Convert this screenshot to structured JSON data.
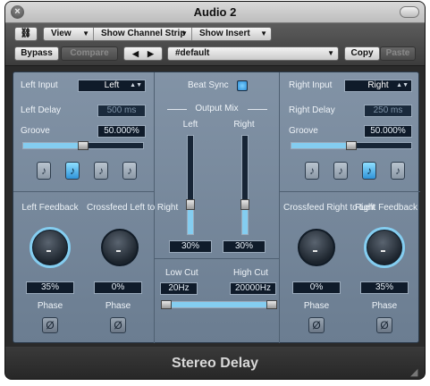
{
  "window": {
    "title": "Audio 2"
  },
  "toolbar": {
    "link_label": "🔗",
    "view": "View",
    "show_channel_strip": "Show Channel Strip",
    "show_insert": "Show Insert",
    "bypass": "Bypass",
    "compare": "Compare",
    "prev": "◀",
    "next": "▶",
    "preset": "#default",
    "copy": "Copy",
    "paste": "Paste"
  },
  "left": {
    "input_label": "Left Input",
    "input_value": "Left",
    "delay_label": "Left Delay",
    "delay_value": "500 ms",
    "groove_label": "Groove",
    "groove_value": "50.000%",
    "groove_fraction": 0.5,
    "notes": [
      "♪",
      "♪",
      "♪",
      "♪"
    ],
    "active_note": 1,
    "feedback_label": "Left Feedback",
    "feedback_value": "35%",
    "feedback_fraction": 0.35,
    "crossfeed_label": "Crossfeed Left to Right",
    "crossfeed_value": "0%",
    "phase_label": "Phase",
    "phase_symbol": "Ø"
  },
  "center": {
    "beat_sync_label": "Beat Sync",
    "output_mix_label": "Output Mix",
    "left_label": "Left",
    "right_label": "Right",
    "left_value": "30%",
    "right_value": "30%",
    "left_fraction": 0.3,
    "right_fraction": 0.3,
    "low_cut_label": "Low Cut",
    "high_cut_label": "High Cut",
    "low_cut_value": "20Hz",
    "high_cut_value": "20000Hz"
  },
  "right": {
    "input_label": "Right Input",
    "input_value": "Right",
    "delay_label": "Right Delay",
    "delay_value": "250 ms",
    "groove_label": "Groove",
    "groove_value": "50.000%",
    "groove_fraction": 0.5,
    "notes": [
      "♪",
      "♪",
      "♪",
      "♪"
    ],
    "active_note": 2,
    "crossfeed_label": "Crossfeed Right to Left",
    "crossfeed_value": "0%",
    "feedback_label": "Right Feedback",
    "feedback_value": "35%",
    "feedback_fraction": 0.35,
    "phase_label": "Phase",
    "phase_symbol": "Ø"
  },
  "footer": {
    "plugin_name": "Stereo Delay"
  },
  "colors": {
    "accent": "#84cdf0",
    "panel": "#7587a0",
    "field_bg": "#0f1b2a"
  }
}
